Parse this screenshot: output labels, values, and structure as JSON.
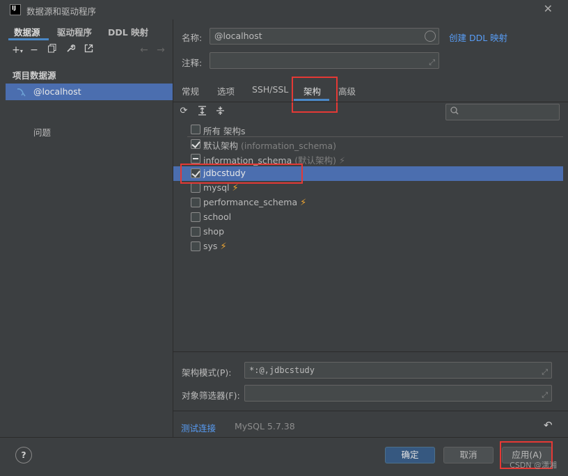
{
  "window": {
    "title": "数据源和驱动程序",
    "app_icon_text": "IJ"
  },
  "left": {
    "tabs": [
      "数据源",
      "驱动程序",
      "DDL 映射"
    ],
    "toolbar": [
      "add-icon",
      "remove-icon",
      "copy-icon",
      "wrench-icon",
      "export-icon",
      "back-icon",
      "forward-icon"
    ],
    "section_title": "项目数据源",
    "datasource": "@localhost",
    "problems": "问题"
  },
  "right": {
    "name_label": "名称:",
    "name_value": "@localhost",
    "create_ddl_link": "创建 DDL 映射",
    "comment_label": "注释:",
    "comment_value": "",
    "tabs": [
      "常规",
      "选项",
      "SSH/SSL",
      "架构",
      "高级"
    ],
    "active_tab": "架构",
    "schemas": [
      {
        "label": "所有 架构s",
        "hint": "",
        "state": "unchecked",
        "bolt": ""
      },
      {
        "label": "默认架构",
        "hint": "(information_schema)",
        "state": "checked",
        "bolt": ""
      },
      {
        "label": "information_schema",
        "hint": "(默认架构)",
        "state": "partial",
        "bolt": "dim"
      },
      {
        "label": "jdbcstudy",
        "hint": "",
        "state": "checked",
        "bolt": "",
        "selected": true
      },
      {
        "label": "mysql",
        "hint": "",
        "state": "unchecked",
        "bolt": "on"
      },
      {
        "label": "performance_schema",
        "hint": "",
        "state": "unchecked",
        "bolt": "on"
      },
      {
        "label": "school",
        "hint": "",
        "state": "unchecked",
        "bolt": ""
      },
      {
        "label": "shop",
        "hint": "",
        "state": "unchecked",
        "bolt": ""
      },
      {
        "label": "sys",
        "hint": "",
        "state": "unchecked",
        "bolt": "on"
      }
    ],
    "schema_pattern_label": "架构模式(P):",
    "schema_pattern_value": "*:@,jdbcstudy",
    "object_filter_label": "对象筛选器(F):",
    "object_filter_value": "",
    "test_connection": "测试连接",
    "version": "MySQL 5.7.38"
  },
  "footer": {
    "help": "?",
    "ok": "确定",
    "cancel": "取消",
    "apply": "应用(A)",
    "watermark": "CSDN @潇湘"
  },
  "colors": {
    "accent": "#4b6eaf",
    "link": "#589df6",
    "highlight": "#e53935",
    "bolt": "#f0a732"
  }
}
